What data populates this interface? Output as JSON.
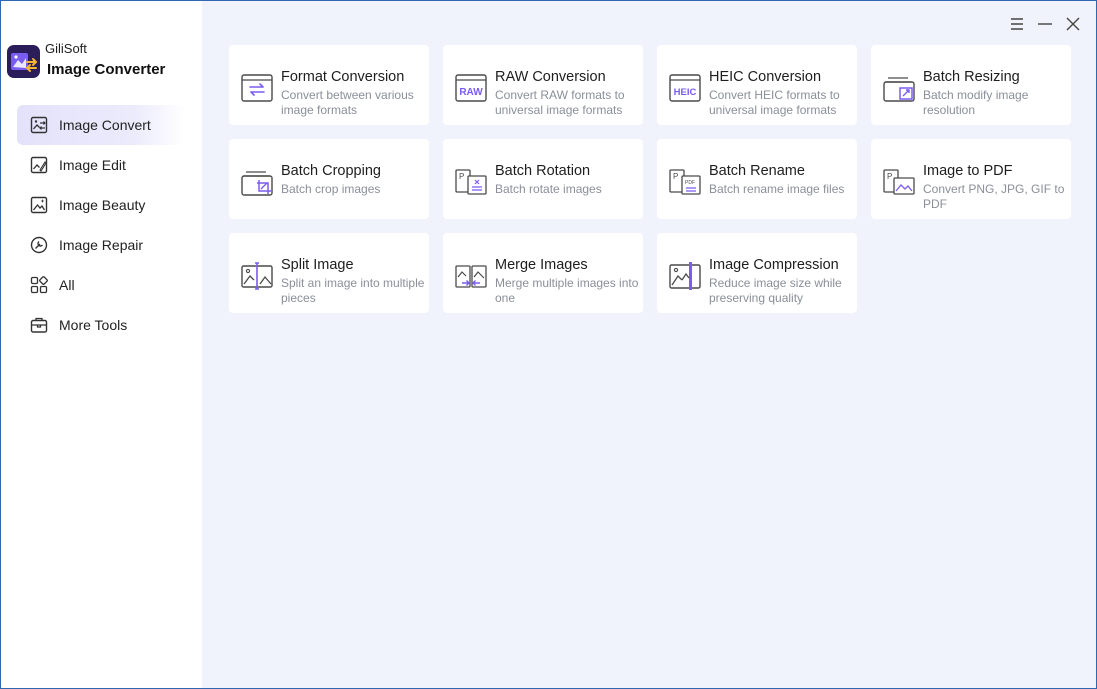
{
  "app": {
    "brand_small": "GiliSoft",
    "brand_name": "Image Converter"
  },
  "window_controls": [
    "menu-icon",
    "minimize-icon",
    "close-icon"
  ],
  "nav": {
    "items": [
      {
        "label": "Image Convert",
        "icon": "image-convert-icon",
        "active": true
      },
      {
        "label": "Image Edit",
        "icon": "image-edit-icon"
      },
      {
        "label": "Image Beauty",
        "icon": "image-beauty-icon"
      },
      {
        "label": "Image Repair",
        "icon": "image-repair-icon"
      },
      {
        "label": "All",
        "icon": "all-grid-icon"
      },
      {
        "label": "More Tools",
        "icon": "toolbox-icon"
      }
    ]
  },
  "cards": [
    {
      "title": "Format Conversion",
      "desc": "Convert between various image formats",
      "icon": "format-conversion-icon"
    },
    {
      "title": "RAW Conversion",
      "desc": "Convert RAW formats to universal image formats",
      "icon": "raw-icon",
      "icon_text": "RAW"
    },
    {
      "title": "HEIC Conversion",
      "desc": "Convert HEIC formats to universal image formats",
      "icon": "heic-icon",
      "icon_text": "HEIC"
    },
    {
      "title": "Batch Resizing",
      "desc": "Batch modify image resolution",
      "icon": "batch-resize-icon"
    },
    {
      "title": "Batch Cropping",
      "desc": "Batch crop images",
      "icon": "batch-crop-icon"
    },
    {
      "title": "Batch Rotation",
      "desc": "Batch rotate images",
      "icon": "batch-rotate-icon"
    },
    {
      "title": "Batch Rename",
      "desc": "Batch rename image files",
      "icon": "batch-rename-icon"
    },
    {
      "title": "Image to PDF",
      "desc": "Convert PNG, JPG, GIF to PDF",
      "icon": "image-to-pdf-icon"
    },
    {
      "title": "Split Image",
      "desc": "Split an image into multiple pieces",
      "icon": "split-image-icon"
    },
    {
      "title": "Merge Images",
      "desc": "Merge multiple images into one",
      "icon": "merge-images-icon"
    },
    {
      "title": "Image Compression",
      "desc": "Reduce image size while preserving quality",
      "icon": "compression-icon"
    }
  ],
  "colors": {
    "accent": "#7b5cf0",
    "icon_gray": "#4a4a4a",
    "desc_gray": "#8a8f99",
    "bg": "#f0f3fc"
  }
}
